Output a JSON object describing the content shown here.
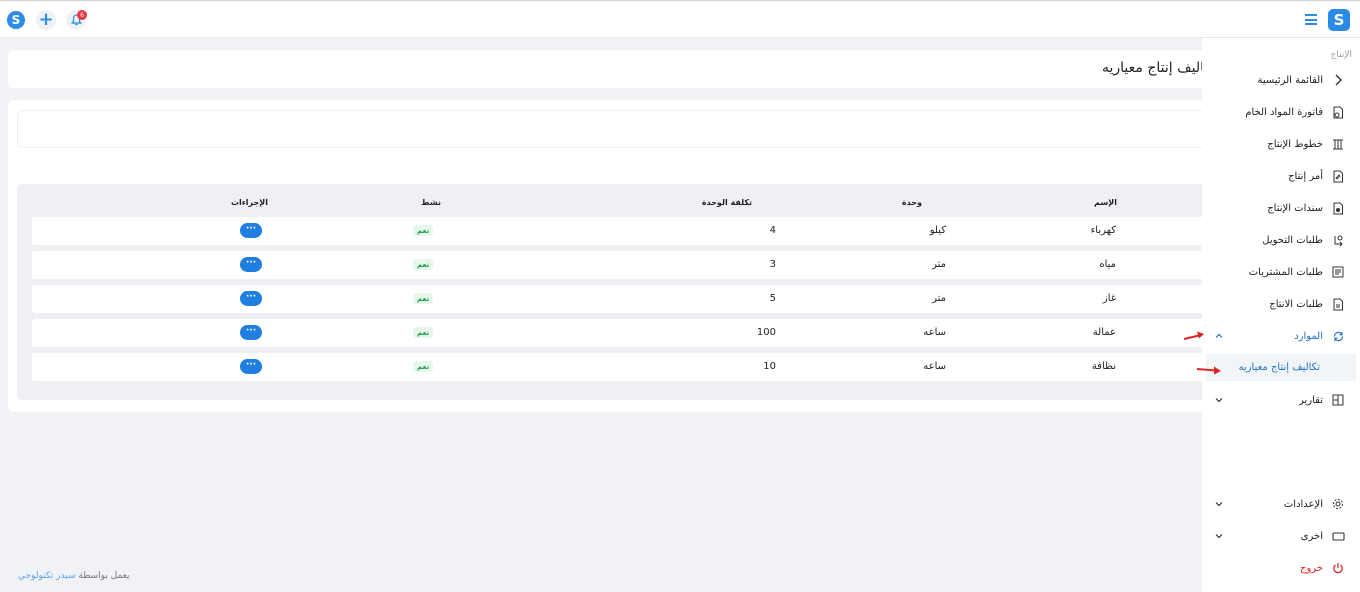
{
  "topbar": {
    "notification_count": "6",
    "brand_colors": {
      "accent": "#2a8be8",
      "badge": "#e63946"
    }
  },
  "sidebar": {
    "section_label": "الإنتاج",
    "main_menu_label": "القائمة الرئيسية",
    "items": [
      {
        "label": "فاتورة المواد الخام",
        "icon": "invoice-icon"
      },
      {
        "label": "خطوط الإنتاج",
        "icon": "production-lines-icon"
      },
      {
        "label": "أمر إنتاج",
        "icon": "production-order-icon"
      },
      {
        "label": "سندات الإنتاج",
        "icon": "production-vouchers-icon"
      },
      {
        "label": "طلبات التحويل",
        "icon": "transfer-requests-icon"
      },
      {
        "label": "طلبات المشتريات",
        "icon": "purchase-requests-icon"
      },
      {
        "label": "طلبات الانتاج",
        "icon": "production-requests-icon"
      }
    ],
    "resources_label": "الموارد",
    "resources_sub_label": "تكاليف إنتاج معياريه",
    "reports_label": "تقارير",
    "settings_label": "الإعدادات",
    "other_label": "اخرى",
    "logout_label": "خروج"
  },
  "page": {
    "title": "تكاليف إنتاج معياريه"
  },
  "table": {
    "columns": {
      "name": "الإسم",
      "unit": "وحدة",
      "unit_cost": "تكلفة الوحدة",
      "active": "نشط",
      "actions": "الإجراءات"
    },
    "rows": [
      {
        "name": "كهرباء",
        "unit": "كيلو",
        "cost": "4",
        "active": "نعم",
        "action": "···"
      },
      {
        "name": "مياه",
        "unit": "متر",
        "cost": "3",
        "active": "نعم",
        "action": "···"
      },
      {
        "name": "غاز",
        "unit": "متر",
        "cost": "5",
        "active": "نعم",
        "action": "···"
      },
      {
        "name": "عمالة",
        "unit": "ساعه",
        "cost": "100",
        "active": "نعم",
        "action": "···"
      },
      {
        "name": "نظافة",
        "unit": "ساعه",
        "cost": "10",
        "active": "نعم",
        "action": "···"
      }
    ]
  },
  "footer": {
    "prefix": "يعمل بواسطة",
    "company": "سيدر تكنولوجي"
  }
}
